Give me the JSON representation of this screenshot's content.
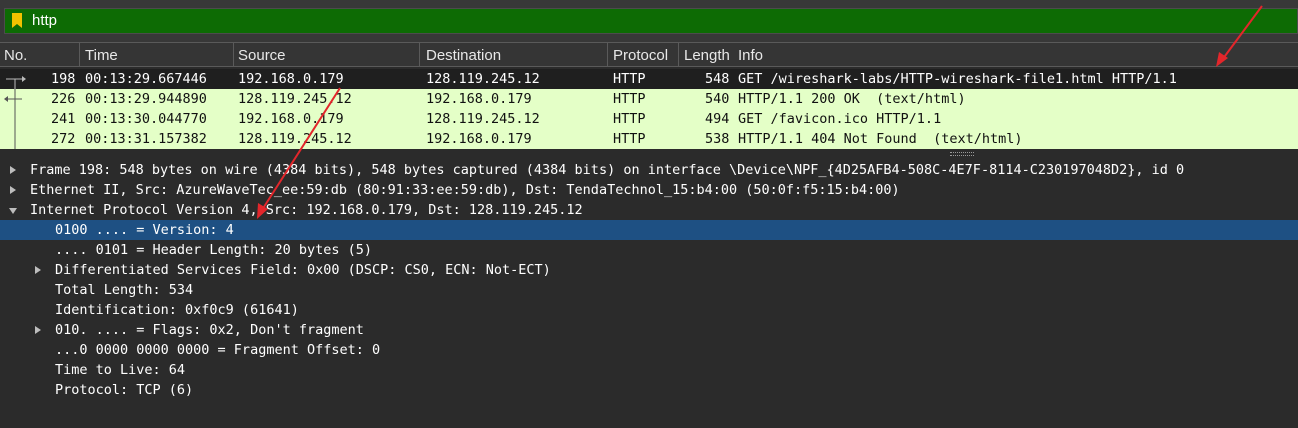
{
  "filter": {
    "value": "http"
  },
  "columns": [
    "No.",
    "Time",
    "Source",
    "Destination",
    "Protocol",
    "Length",
    "Info"
  ],
  "packets": [
    {
      "no": "198",
      "time": "00:13:29.667446",
      "source": "192.168.0.179",
      "destination": "128.119.245.12",
      "protocol": "HTTP",
      "length": "548",
      "info": "GET /wireshark-labs/HTTP-wireshark-file1.html HTTP/1.1"
    },
    {
      "no": "226",
      "time": "00:13:29.944890",
      "source": "128.119.245.12",
      "destination": "192.168.0.179",
      "protocol": "HTTP",
      "length": "540",
      "info": "HTTP/1.1 200 OK  (text/html)"
    },
    {
      "no": "241",
      "time": "00:13:30.044770",
      "source": "192.168.0.179",
      "destination": "128.119.245.12",
      "protocol": "HTTP",
      "length": "494",
      "info": "GET /favicon.ico HTTP/1.1"
    },
    {
      "no": "272",
      "time": "00:13:31.157382",
      "source": "128.119.245.12",
      "destination": "192.168.0.179",
      "protocol": "HTTP",
      "length": "538",
      "info": "HTTP/1.1 404 Not Found  (text/html)"
    }
  ],
  "details": [
    {
      "text": "Frame 198: 548 bytes on wire (4384 bits), 548 bytes captured (4384 bits) on interface \\Device\\NPF_{4D25AFB4-508C-4E7F-8114-C230197048D2}, id 0"
    },
    {
      "text": "Ethernet II, Src: AzureWaveTec_ee:59:db (80:91:33:ee:59:db), Dst: TendaTechnol_15:b4:00 (50:0f:f5:15:b4:00)"
    },
    {
      "text": "Internet Protocol Version 4, Src: 192.168.0.179, Dst: 128.119.245.12"
    },
    {
      "text": "0100 .... = Version: 4"
    },
    {
      "text": ".... 0101 = Header Length: 20 bytes (5)"
    },
    {
      "text": "Differentiated Services Field: 0x00 (DSCP: CS0, ECN: Not-ECT)"
    },
    {
      "text": "Total Length: 534"
    },
    {
      "text": "Identification: 0xf0c9 (61641)"
    },
    {
      "text": "010. .... = Flags: 0x2, Don't fragment"
    },
    {
      "text": "...0 0000 0000 0000 = Fragment Offset: 0"
    },
    {
      "text": "Time to Live: 64"
    },
    {
      "text": "Protocol: TCP (6)"
    }
  ],
  "colors": {
    "filter_valid": "#0d6b04",
    "http_row": "#e4ffc7",
    "selected_packet": "#1f1f1f",
    "selected_detail": "#1e5083",
    "annotation_arrow": "#e3262b"
  }
}
